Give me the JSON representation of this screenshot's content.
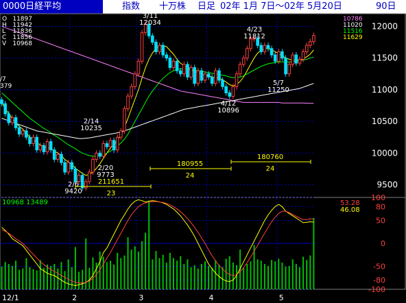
{
  "header": {
    "title": "0000日経平均",
    "index_label": "指数",
    "unit_label": "十万株",
    "period_label": "日足",
    "date_range": "02年  1月  7日～02年  5月20日",
    "days": "90日"
  },
  "ohlcv": [
    {
      "k": "O",
      "v": "11897"
    },
    {
      "k": "H",
      "v": "11942"
    },
    {
      "k": "L",
      "v": "11836"
    },
    {
      "k": "C",
      "v": "11856"
    },
    {
      "k": "V",
      "v": "10968"
    }
  ],
  "ma_values": [
    {
      "v": "10786",
      "color": "#ff80ff"
    },
    {
      "v": "11020",
      "color": "#ffffff"
    },
    {
      "v": "11516",
      "color": "#00ff00"
    },
    {
      "v": "11629",
      "color": "#ffff00"
    }
  ],
  "left_edge_labels": [
    "/7",
    "379"
  ],
  "lower_panel_label": "10968  13489",
  "osc_values": [
    {
      "v": "53.28",
      "color": "#ff4040"
    },
    {
      "v": "46.08",
      "color": "#ffff00"
    }
  ],
  "annotations": [
    {
      "id": "a311",
      "lines": [
        "3/11",
        "12034"
      ]
    },
    {
      "id": "a423",
      "lines": [
        "4/23",
        "11812"
      ]
    },
    {
      "id": "a214",
      "lines": [
        "2/14",
        "10235"
      ]
    },
    {
      "id": "a57",
      "lines": [
        "5/7",
        "11250"
      ]
    },
    {
      "id": "a412",
      "lines": [
        "4/12",
        "10896"
      ]
    },
    {
      "id": "a220",
      "lines": [
        "2/20",
        "9773"
      ]
    },
    {
      "id": "a26",
      "lines": [
        "2/6",
        "9420"
      ]
    }
  ],
  "interval_labels": {
    "int1_vol": "180955",
    "int1_days": "24",
    "int2_vol": "180760",
    "int2_days": "24",
    "int3_vol": "211651",
    "int3_days": "23"
  },
  "chart_data": [
    {
      "type": "candlestick",
      "title": "0000日経平均",
      "ylim": [
        9300,
        12200
      ],
      "yticks": [
        9500,
        10000,
        10500,
        11000,
        11500,
        12000
      ],
      "xticks": [
        {
          "label": "12/1",
          "day": 0
        },
        {
          "label": "2",
          "day": 20
        },
        {
          "label": "3",
          "day": 39
        },
        {
          "label": "4",
          "day": 59
        },
        {
          "label": "5",
          "day": 79
        }
      ],
      "closes": [
        10780,
        10620,
        10480,
        10560,
        10400,
        10300,
        10350,
        10250,
        10150,
        10250,
        10050,
        10120,
        10020,
        10180,
        10050,
        9900,
        9980,
        9850,
        9700,
        9850,
        9750,
        9550,
        9650,
        9450,
        9550,
        9700,
        9900,
        10000,
        9950,
        10150,
        10100,
        10200,
        10050,
        10250,
        10350,
        10700,
        10900,
        11050,
        11250,
        11450,
        11900,
        12034,
        11850,
        11750,
        11600,
        11700,
        11550,
        11500,
        11350,
        11450,
        11300,
        11250,
        11400,
        11200,
        11350,
        11100,
        11300,
        11150,
        11250,
        11200,
        11100,
        11300,
        11150,
        11050,
        10950,
        10896,
        11050,
        11250,
        11400,
        11500,
        11650,
        11800,
        11812,
        11700,
        11600,
        11700,
        11650,
        11550,
        11450,
        11600,
        11500,
        11250,
        11400,
        11550,
        11420,
        11480,
        11600,
        11700,
        11760,
        11856
      ],
      "series": [
        {
          "name": "MA1",
          "color": "#ffff00",
          "values": [
            10800,
            10700,
            10620,
            10550,
            10480,
            10420,
            10380,
            10320,
            10250,
            10220,
            10160,
            10130,
            10100,
            10090,
            10070,
            10030,
            10000,
            9960,
            9900,
            9860,
            9820,
            9760,
            9720,
            9680,
            9650,
            9660,
            9700,
            9760,
            9830,
            9920,
            10000,
            10080,
            10130,
            10200,
            10280,
            10400,
            10550,
            10700,
            10850,
            11000,
            11180,
            11350,
            11480,
            11580,
            11650,
            11700,
            11700,
            11680,
            11620,
            11560,
            11480,
            11420,
            11380,
            11350,
            11320,
            11290,
            11270,
            11250,
            11230,
            11220,
            11200,
            11190,
            11180,
            11160,
            11120,
            11080,
            11060,
            11080,
            11130,
            11200,
            11300,
            11400,
            11500,
            11580,
            11620,
            11650,
            11650,
            11630,
            11600,
            11570,
            11540,
            11500,
            11480,
            11470,
            11460,
            11470,
            11490,
            11520,
            11560,
            11629
          ]
        },
        {
          "name": "MA2",
          "color": "#00ff00",
          "values": [
            10950,
            10900,
            10850,
            10800,
            10750,
            10700,
            10650,
            10600,
            10550,
            10510,
            10470,
            10430,
            10390,
            10360,
            10320,
            10280,
            10250,
            10210,
            10170,
            10130,
            10100,
            10070,
            10030,
            10000,
            9980,
            9960,
            9950,
            9950,
            9960,
            9980,
            10000,
            10030,
            10070,
            10110,
            10160,
            10220,
            10300,
            10400,
            10500,
            10600,
            10700,
            10800,
            10900,
            10980,
            11050,
            11120,
            11180,
            11230,
            11270,
            11300,
            11320,
            11330,
            11330,
            11330,
            11320,
            11310,
            11300,
            11290,
            11280,
            11270,
            11260,
            11250,
            11240,
            11230,
            11220,
            11200,
            11190,
            11190,
            11200,
            11220,
            11250,
            11280,
            11310,
            11340,
            11370,
            11390,
            11410,
            11420,
            11430,
            11440,
            11440,
            11440,
            11440,
            11440,
            11450,
            11460,
            11470,
            11480,
            11500,
            11516
          ]
        },
        {
          "name": "MA3",
          "color": "#ffffff",
          "values": [
            10550,
            10530,
            10510,
            10490,
            10470,
            10450,
            10430,
            10410,
            10390,
            10370,
            10350,
            10340,
            10330,
            10320,
            10310,
            10300,
            10290,
            10280,
            10270,
            10260,
            10250,
            10240,
            10230,
            10230,
            10235,
            10240,
            10250,
            10260,
            10270,
            10280,
            10290,
            10300,
            10310,
            10320,
            10330,
            10350,
            10370,
            10390,
            10410,
            10430,
            10450,
            10470,
            10490,
            10510,
            10530,
            10550,
            10570,
            10590,
            10610,
            10630,
            10650,
            10670,
            10690,
            10700,
            10710,
            10720,
            10730,
            10740,
            10750,
            10760,
            10770,
            10780,
            10790,
            10800,
            10810,
            10820,
            10830,
            10840,
            10850,
            10860,
            10870,
            10880,
            10890,
            10900,
            10910,
            10920,
            10930,
            10940,
            10950,
            10960,
            10970,
            10980,
            10990,
            11000,
            11010,
            11020,
            11040,
            11060,
            11080,
            11100
          ]
        },
        {
          "name": "MA4",
          "color": "#ff80ff",
          "values": [
            12000,
            11980,
            11960,
            11940,
            11920,
            11900,
            11880,
            11860,
            11840,
            11820,
            11800,
            11780,
            11760,
            11740,
            11720,
            11700,
            11680,
            11660,
            11640,
            11620,
            11600,
            11580,
            11560,
            11540,
            11520,
            11500,
            11480,
            11460,
            11440,
            11420,
            11400,
            11380,
            11360,
            11340,
            11320,
            11300,
            11280,
            11260,
            11240,
            11220,
            11200,
            11180,
            11160,
            11140,
            11120,
            11100,
            11080,
            11060,
            11040,
            11020,
            11000,
            10980,
            10970,
            10960,
            10950,
            10940,
            10930,
            10920,
            10910,
            10900,
            10890,
            10880,
            10870,
            10860,
            10850,
            10840,
            10830,
            10820,
            10810,
            10800,
            10800,
            10800,
            10800,
            10800,
            10800,
            10800,
            10800,
            10800,
            10800,
            10800,
            10790,
            10790,
            10790,
            10790,
            10790,
            10790,
            10790,
            10788,
            10787,
            10786
          ]
        }
      ]
    },
    {
      "type": "bar+line",
      "title": "oscillator",
      "ylim": [
        -100,
        100
      ],
      "yticks": [
        100,
        80,
        50,
        0,
        -50,
        -80,
        -100
      ],
      "volume_max": 13489,
      "volume": [
        3500,
        4200,
        3900,
        3600,
        4400,
        3000,
        3200,
        4800,
        3400,
        3100,
        2900,
        4500,
        3300,
        3800,
        3600,
        3900,
        3200,
        4200,
        2800,
        4600,
        3400,
        6500,
        2700,
        3000,
        7800,
        3300,
        4900,
        4100,
        5800,
        5000,
        4200,
        4400,
        3800,
        5600,
        4800,
        5200,
        8000,
        6100,
        6600,
        5800,
        7400,
        8700,
        13489,
        4600,
        5900,
        4800,
        5300,
        4100,
        5600,
        4800,
        4400,
        5100,
        3900,
        4600,
        3400,
        3700,
        3200,
        3900,
        4300,
        3600,
        3300,
        4500,
        3800,
        3400,
        4700,
        5100,
        4100,
        3700,
        6100,
        3300,
        3900,
        4300,
        6800,
        4600,
        4400,
        3900,
        3600,
        4500,
        4300,
        4700,
        4100,
        3500,
        3600,
        4600,
        3900,
        3400,
        5000,
        4500,
        5200,
        10968
      ],
      "series": [
        {
          "name": "line-yellow",
          "color": "#ffff00",
          "values": [
            35,
            28,
            20,
            10,
            5,
            0,
            -5,
            -15,
            -25,
            -35,
            -45,
            -55,
            -60,
            -65,
            -68,
            -70,
            -75,
            -80,
            -85,
            -88,
            -90,
            -92,
            -90,
            -88,
            -85,
            -80,
            -70,
            -55,
            -40,
            -20,
            -10,
            5,
            20,
            35,
            50,
            62,
            75,
            85,
            92,
            95,
            93,
            90,
            92,
            93,
            92,
            90,
            88,
            85,
            80,
            75,
            68,
            60,
            50,
            40,
            28,
            15,
            0,
            -15,
            -30,
            -45,
            -55,
            -65,
            -72,
            -78,
            -82,
            -83,
            -80,
            -70,
            -55,
            -40,
            -25,
            -10,
            5,
            20,
            35,
            50,
            62,
            72,
            80,
            85,
            80,
            70,
            65,
            60,
            55,
            50,
            45,
            46,
            47,
            46.08
          ]
        },
        {
          "name": "line-red",
          "color": "#ff4040",
          "values": [
            30,
            26,
            22,
            16,
            10,
            5,
            0,
            -8,
            -16,
            -24,
            -32,
            -40,
            -46,
            -52,
            -57,
            -61,
            -65,
            -70,
            -74,
            -78,
            -82,
            -85,
            -86,
            -86,
            -85,
            -82,
            -76,
            -68,
            -58,
            -45,
            -32,
            -20,
            -6,
            8,
            22,
            36,
            50,
            62,
            72,
            80,
            85,
            88,
            90,
            91,
            91,
            90,
            89,
            87,
            84,
            80,
            75,
            69,
            62,
            54,
            45,
            35,
            24,
            12,
            0,
            -14,
            -27,
            -38,
            -48,
            -56,
            -63,
            -68,
            -70,
            -68,
            -62,
            -53,
            -42,
            -30,
            -17,
            -4,
            9,
            22,
            35,
            47,
            57,
            65,
            70,
            70,
            67,
            63,
            59,
            55,
            52,
            52,
            53,
            53.28
          ]
        }
      ]
    }
  ]
}
